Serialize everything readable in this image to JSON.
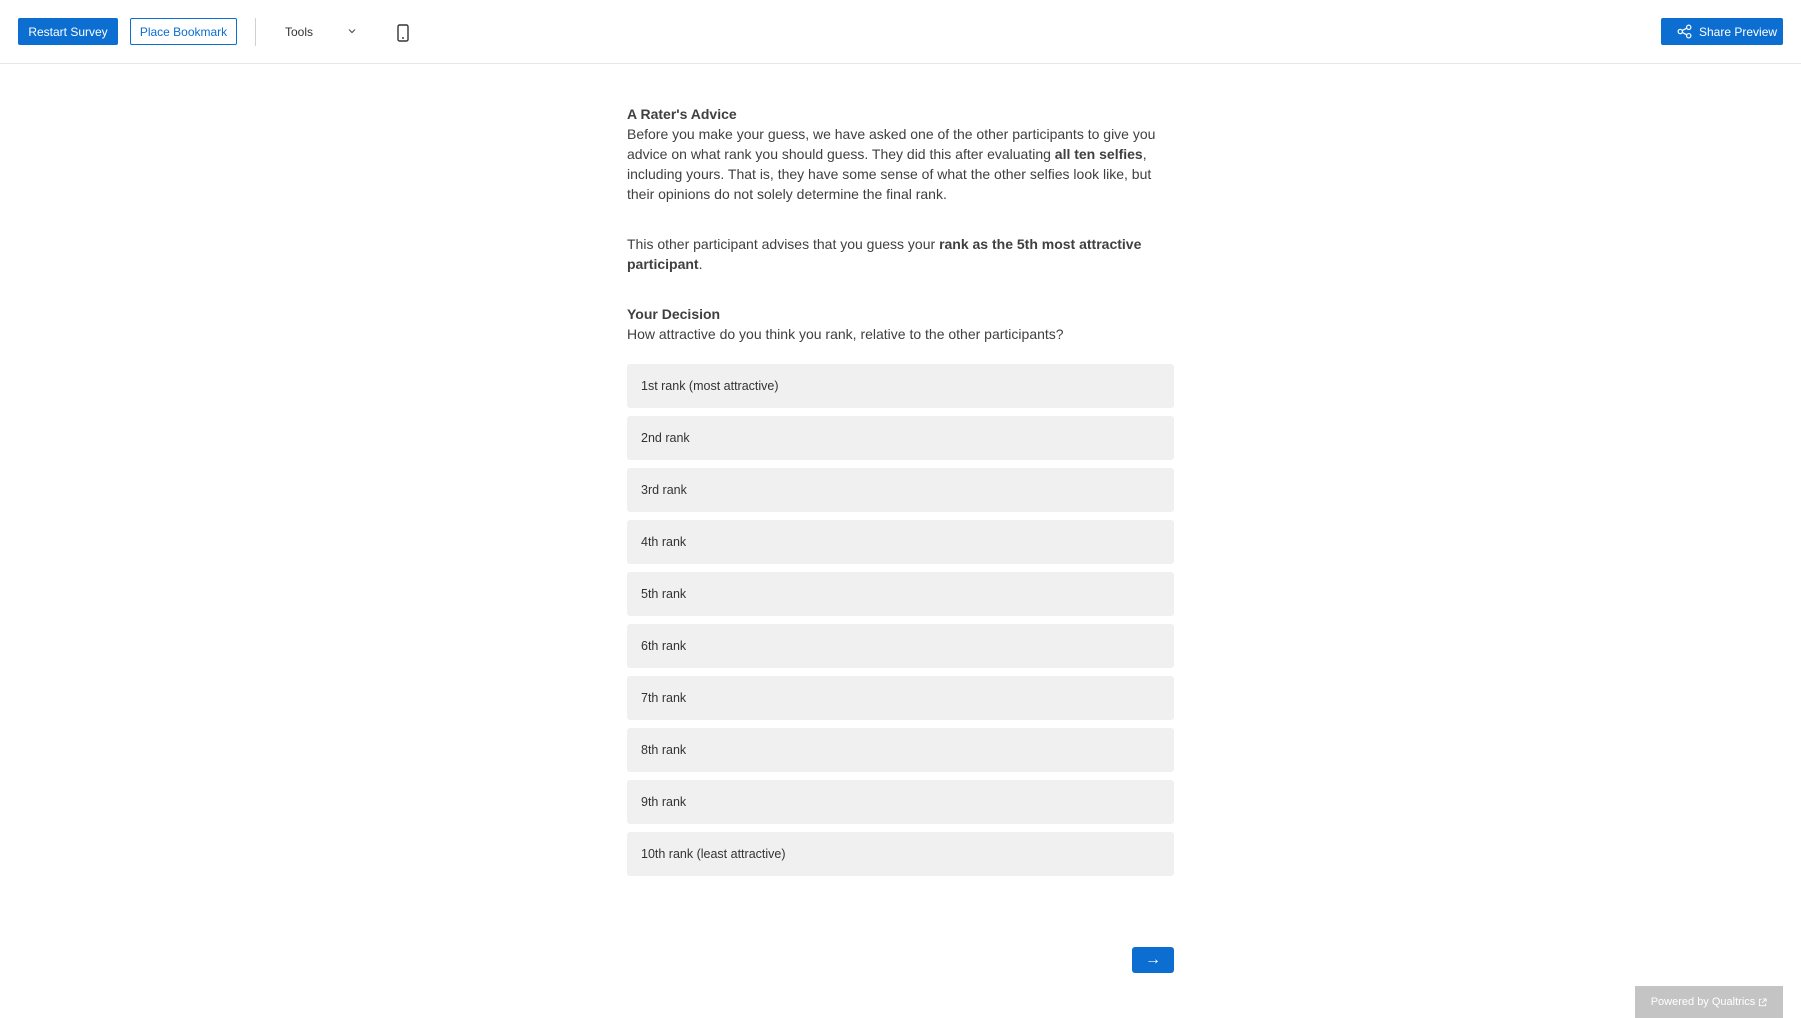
{
  "toolbar": {
    "restart_label": "Restart Survey",
    "bookmark_label": "Place Bookmark",
    "tools_label": "Tools",
    "share_label": "Share Preview"
  },
  "advice": {
    "title": "A Rater's Advice",
    "p1_part1": "Before you make your guess, we have asked one of the other participants to give you advice on what rank you should guess. They did this after evaluating ",
    "p1_bold": "all ten selfies",
    "p1_part2": ", including yours. That is, they have some sense of what the other selfies look like, but their opinions do not solely determine the final rank.",
    "p2_part1": "This other participant advises that you guess your ",
    "p2_bold": "rank as the 5th most attractive participant",
    "p2_part2": "."
  },
  "decision": {
    "title": "Your Decision",
    "question": "How attractive do you think you rank, relative to the other participants?"
  },
  "choices": [
    "1st rank (most attractive)",
    "2nd rank",
    "3rd rank",
    "4th rank",
    "5th rank",
    "6th rank",
    "7th rank",
    "8th rank",
    "9th rank",
    "10th rank (least attractive)"
  ],
  "next_label": "→",
  "footer": {
    "powered_label": "Powered by Qualtrics"
  },
  "colors": {
    "accent": "#0b6ed0",
    "choice_bg": "#f0f0f0",
    "text": "#404040"
  }
}
